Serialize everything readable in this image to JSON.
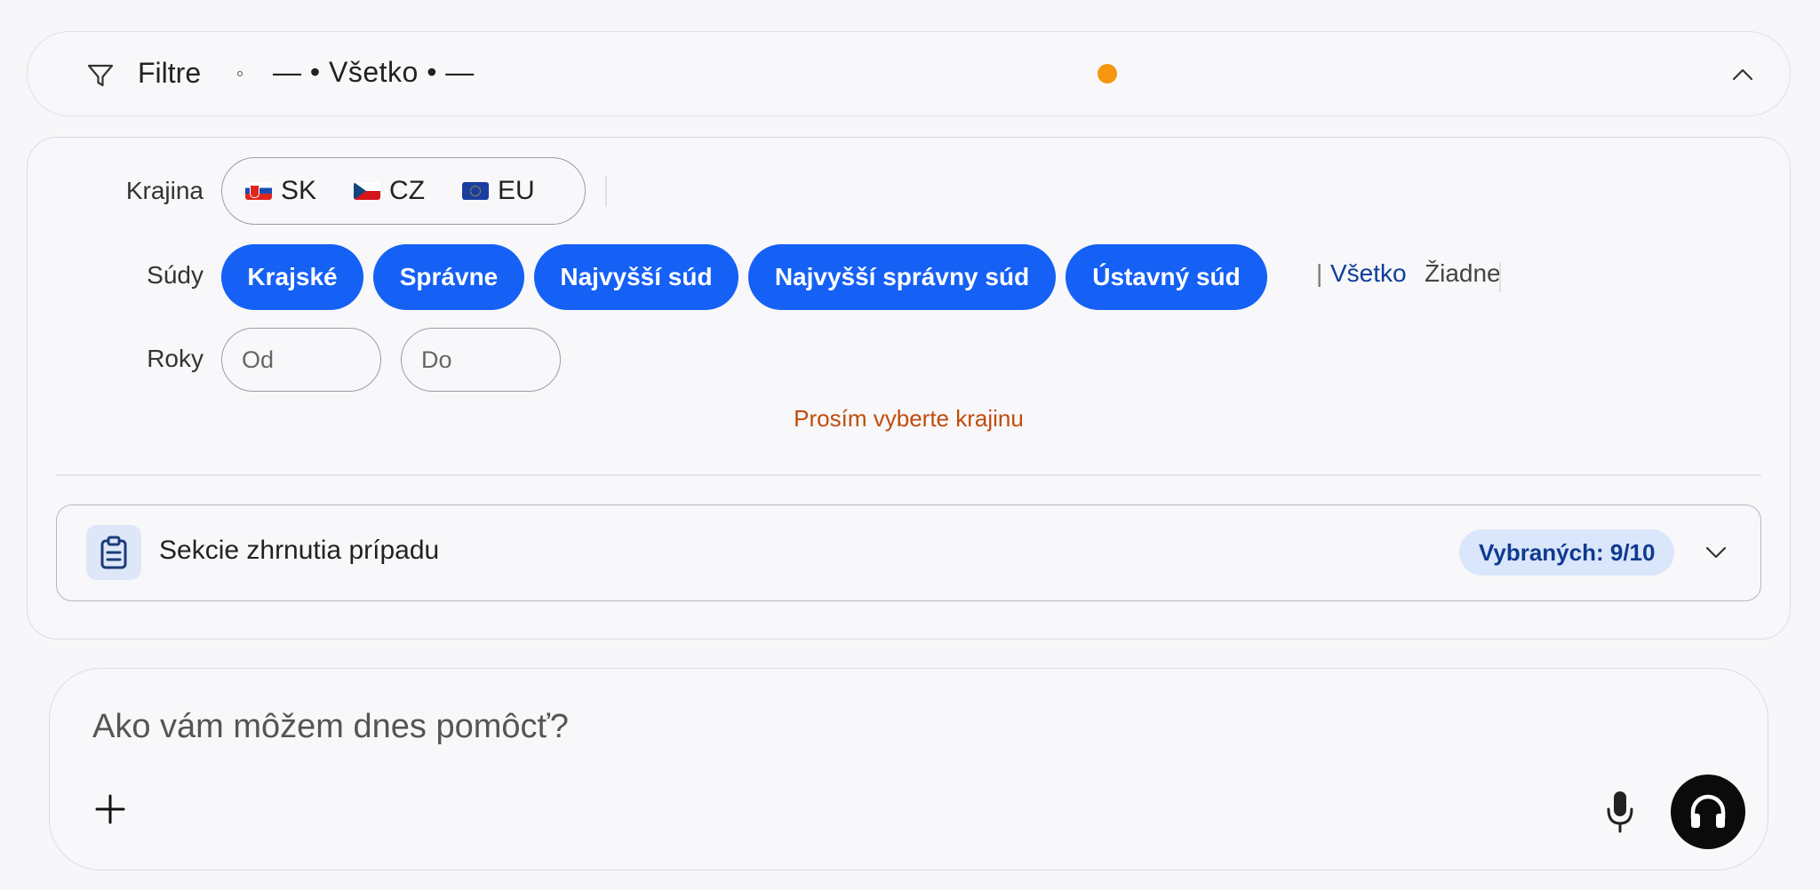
{
  "filter_bar": {
    "title": "Filtre",
    "summary": "— • Všetko • —",
    "status_color": "#f5960f"
  },
  "panel": {
    "country": {
      "label": "Krajina",
      "options": [
        {
          "code": "SK",
          "flag": "slovakia-flag"
        },
        {
          "code": "CZ",
          "flag": "czech-flag"
        },
        {
          "code": "EU",
          "flag": "eu-flag"
        }
      ]
    },
    "courts": {
      "label": "Súdy",
      "chips": [
        "Krajské",
        "Správne",
        "Najvyšší súd",
        "Najvyšší správny súd",
        "Ústavný súd"
      ],
      "separator": "|",
      "select_all": "Všetko",
      "select_none": "Žiadne",
      "chip_color": "#1560f5"
    },
    "years": {
      "label": "Roky",
      "from_placeholder": "Od",
      "to_placeholder": "Do"
    },
    "warning": "Prosím vyberte krajinu",
    "summary_sections": {
      "title": "Sekcie zhrnutia prípadu",
      "badge": "Vybraných: 9/10"
    }
  },
  "chat": {
    "placeholder": "Ako vám môžem dnes pomôcť?"
  }
}
